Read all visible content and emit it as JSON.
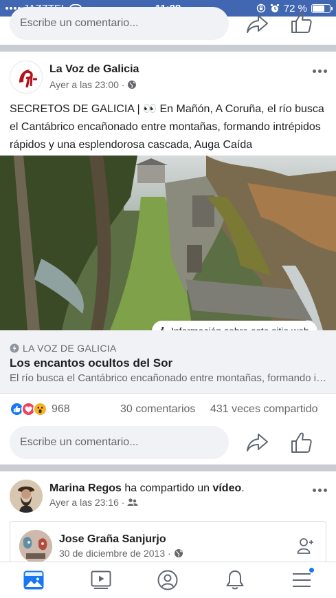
{
  "status_bar": {
    "carrier": "JAZZTEL",
    "time": "11:28",
    "battery": "72 %",
    "battery_level": 0.72
  },
  "top_comment": {
    "placeholder": "Escribe un comentario..."
  },
  "post": {
    "author": "La Voz de Galicia",
    "meta": "Ayer a las 23:00 ·",
    "text": "SECRETOS DE GALICIA | 👀 En Mañón, A Coruña, el río busca el Cantábrico encañonado entre montañas, formando intrépidos rápidos y una esplendorosa cascada, Auga Caída",
    "info_label": "Información sobre este sitio web",
    "link": {
      "domain": "LA VOZ DE GALICIA",
      "title": "Los encantos ocultos del Sor",
      "description": "El río busca el Cantábrico encañonado entre montañas, formando intrépidos rápidos y una esplendorosa cascada"
    },
    "reactions_count": "968",
    "comments": "30 comentarios",
    "shares": "431 veces compartido",
    "comment_placeholder": "Escribe un comentario..."
  },
  "post2": {
    "author": "Marina Regos",
    "action_mid": " ha compartido un ",
    "action_obj": "vídeo",
    "action_end": ".",
    "meta": "Ayer a las 23:16 ·",
    "shared": {
      "author": "Jose Graña Sanjurjo",
      "meta": "30 de diciembre de 2013 ·"
    }
  },
  "icons": {
    "tabs": [
      "news-feed-icon",
      "watch-icon",
      "profile-icon",
      "notifications-icon",
      "menu-icon"
    ]
  },
  "colors": {
    "brand": "#4267b2",
    "active_tab": "#1877f2",
    "divider": "#c9ccd1"
  }
}
